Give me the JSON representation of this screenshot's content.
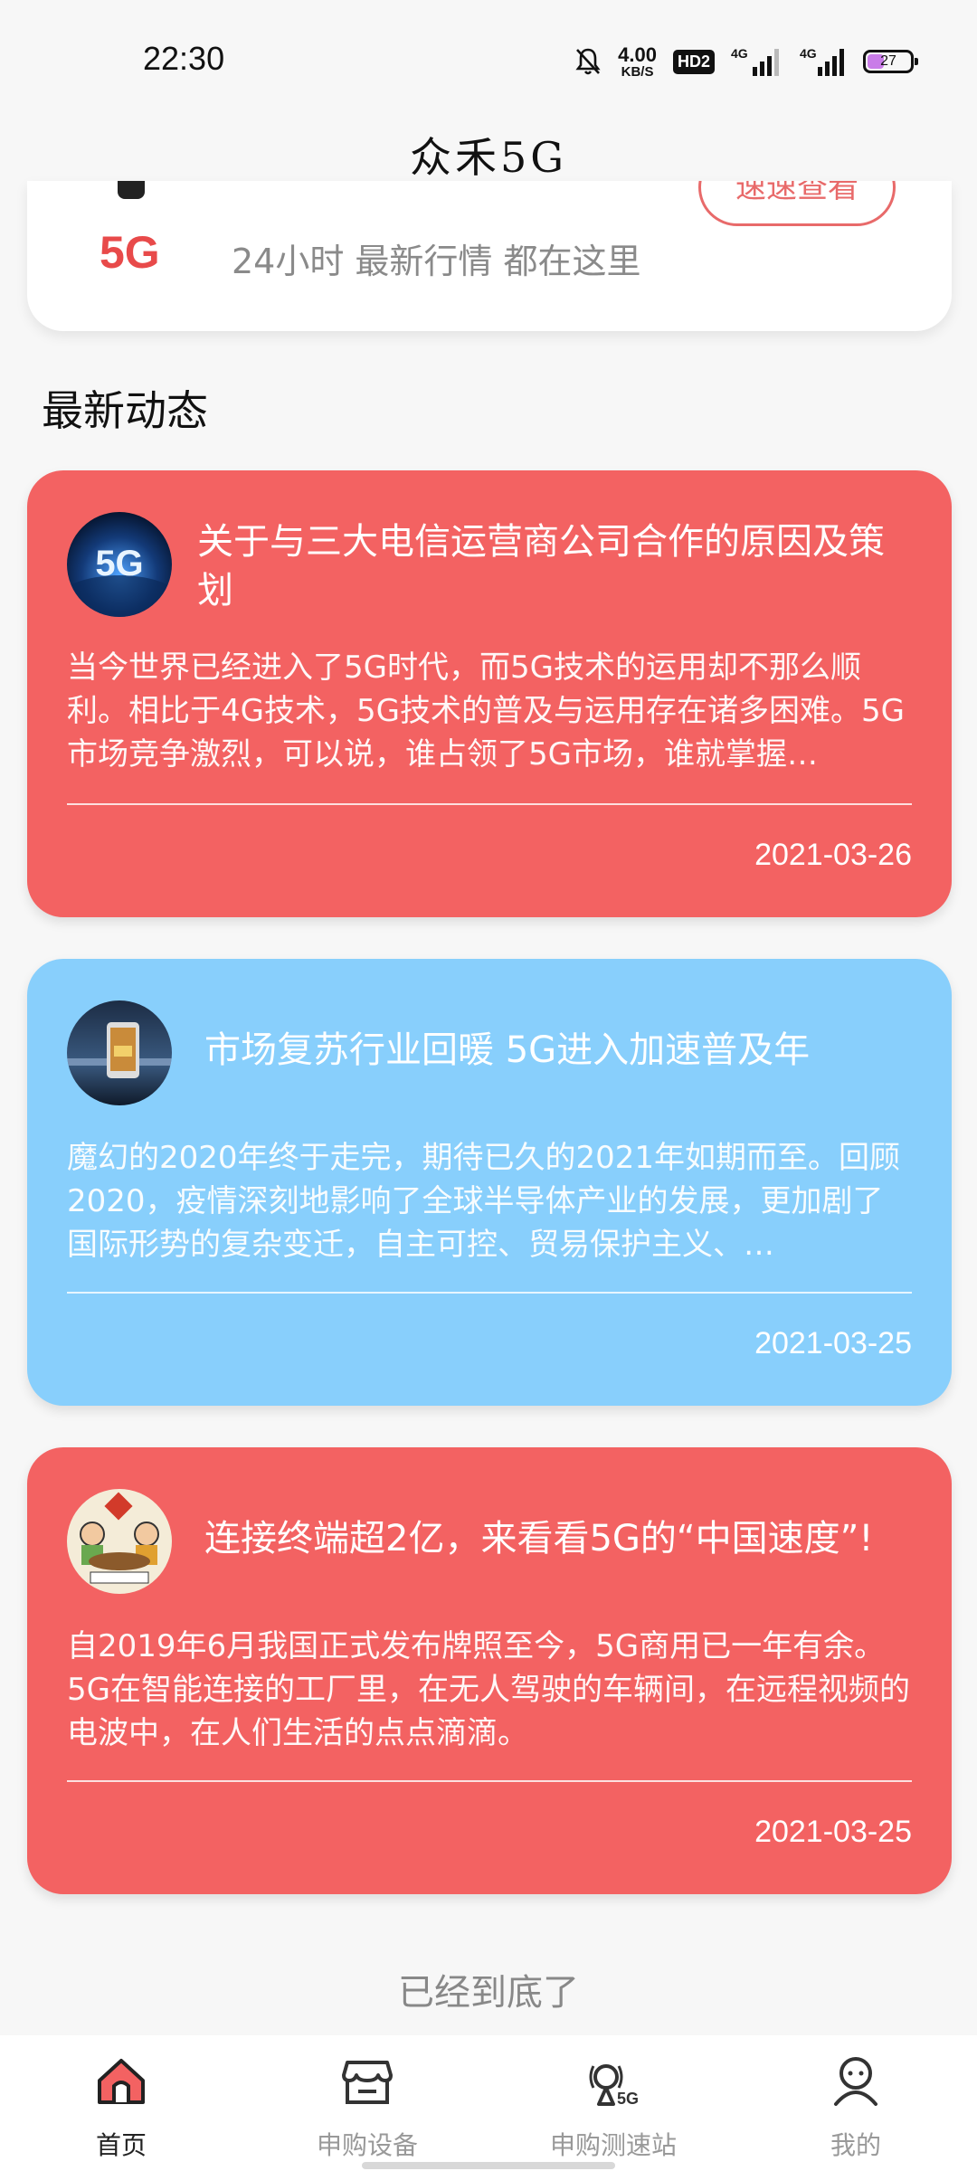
{
  "status_bar": {
    "time": "22:30",
    "speed_value": "4.00",
    "speed_unit": "KB/S",
    "hd_badge": "HD2",
    "signal1_label": "4G",
    "signal2_label": "4G",
    "battery": "27",
    "icons": [
      "bell-mute-icon",
      "signal-icon",
      "signal-icon",
      "battery-icon"
    ]
  },
  "header": {
    "title": "众禾5G"
  },
  "top_card": {
    "logo_text": "5G",
    "subtitle": "24小时 最新行情 都在这里",
    "button_label": "速速查看"
  },
  "section": {
    "title": "最新动态"
  },
  "news": [
    {
      "title": "关于与三大电信运营商公司合作的原因及策划",
      "body": "当今世界已经进入了5G时代，而5G技术的运用却不那么顺利。相比于4G技术，5G技术的普及与运用存在诸多困难。5G市场竞争激烈，可以说，谁占领了5G市场，谁就掌握…",
      "date": "2021-03-26",
      "color": "#f36262",
      "avatar_label": "5G"
    },
    {
      "title": "市场复苏行业回暖 5G进入加速普及年",
      "body": "魔幻的2020年终于走完，期待已久的2021年如期而至。回顾2020，疫情深刻地影响了全球半导体产业的发展，更加剧了国际形势的复杂变迁，自主可控、贸易保护主义、…",
      "date": "2021-03-25",
      "color": "#88cffc"
    },
    {
      "title": "连接终端超2亿，来看看5G的“中国速度”!",
      "body": "自2019年6月我国正式发布牌照至今，5G商用已一年有余。5G在智能连接的工厂里，在无人驾驶的车辆间，在远程视频的电波中，在人们生活的点点滴滴。",
      "date": "2021-03-25",
      "color": "#f36262"
    }
  ],
  "footer": {
    "end_text": "已经到底了"
  },
  "bottom_nav": [
    {
      "label": "首页",
      "icon": "home-icon",
      "active": true
    },
    {
      "label": "申购设备",
      "icon": "store-icon",
      "active": false
    },
    {
      "label": "申购测速站",
      "icon": "5g-station-icon",
      "active": false
    },
    {
      "label": "我的",
      "icon": "profile-icon",
      "active": false
    }
  ]
}
